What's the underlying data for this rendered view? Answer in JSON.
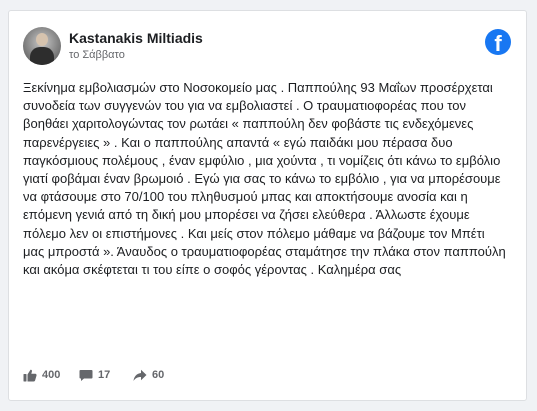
{
  "post": {
    "author": "Kastanakis Miltiadis",
    "timestamp": "το Σάββατο",
    "text": "Ξεκίνημα εμβολιασμών στο Νοσοκομείο μας . Παππούλης 93 Μαΐων προσέρχεται συνοδεία των συγγενών του για να εμβολιαστεί . Ο τραυματιοφορέας που τον βοηθάει χαριτολογώντας τον ρωτάει « παππούλη δεν φοβάστε τις ενδεχόμενες παρενέργειες » . Και ο παππούλης απαντά « εγώ παιδάκι μου πέρασα δυο παγκόσμιους πολέμους , έναν εμφύλιο , μια χούντα , τι νομίζεις ότι κάνω το εμβόλιο γιατί φοβάμαι έναν βρωμοιό . Εγώ για σας το κάνω το εμβόλιο , για να μπορέσουμε να φτάσουμε στο 70/100 του πληθυσμού μπας και αποκτήσουμε ανοσία και η επόμενη γενιά από τη δική μου μπορέσει να ζήσει ελεύθερα . Άλλωστε έχουμε πόλεμο λεν οι επιστήμονες . Και μείς στον πόλεμο μάθαμε να βάζουμε τον Μπέτι μας μπροστά ». Άναυδος ο τραυματιοφορέας σταμάτησε την πλάκα στον παππούλη και ακόμα σκέφτεται τι του είπε ο σοφός γέροντας . Καλημέρα σας"
  },
  "stats": {
    "likes": "400",
    "comments": "17",
    "shares": "60"
  },
  "colors": {
    "brand": "#1877f2",
    "text": "#1c1e21",
    "secondary": "#65676b"
  },
  "icons": {
    "logo": "facebook-logo-icon",
    "like": "thumbs-up-icon",
    "comment": "comment-bubble-icon",
    "share": "share-arrow-icon"
  }
}
